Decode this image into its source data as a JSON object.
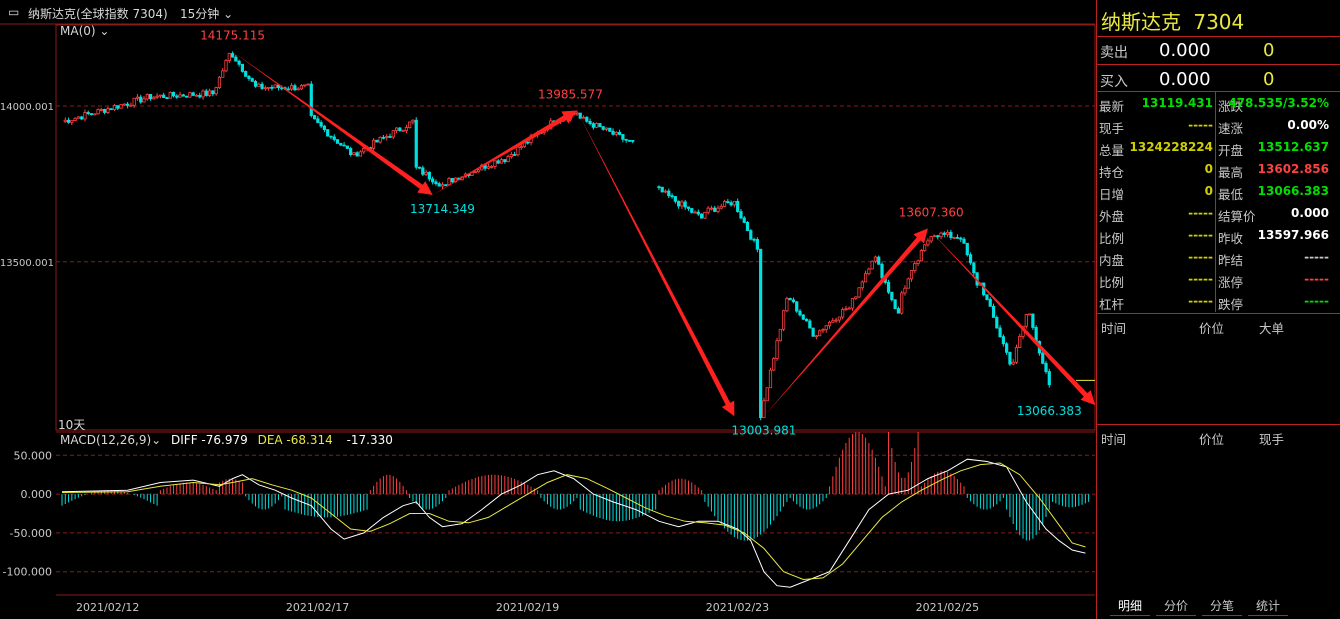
{
  "header": {
    "instrument": "纳斯达克(全球指数 7304)",
    "period": "15分钟",
    "ma_label": "MA(0)",
    "range_label": "10天",
    "icon": "chart-window-icon"
  },
  "macd": {
    "label": "MACD(12,26,9)",
    "diff": "DIFF -76.979",
    "dea": "DEA -68.314",
    "macd": "-17.330"
  },
  "quote": {
    "name": "纳斯达克",
    "code": "7304",
    "sell_label": "卖出",
    "sell_price": "0.000",
    "sell_vol": "0",
    "buy_label": "买入",
    "buy_price": "0.000",
    "buy_vol": "0",
    "rows": [
      {
        "l1": "最新",
        "v1": "13119.431",
        "c1": "#00e000",
        "l2": "涨跌",
        "v2": "478.535/3.52%",
        "c2": "#00e000"
      },
      {
        "l1": "现手",
        "v1": "-----",
        "c1": "#d0d000",
        "l2": "速涨",
        "v2": "0.00%",
        "c2": "#ffffff"
      },
      {
        "l1": "总量",
        "v1": "1324228224",
        "c1": "#d0d000",
        "l2": "开盘",
        "v2": "13512.637",
        "c2": "#00e000"
      },
      {
        "l1": "持仓",
        "v1": "0",
        "c1": "#d0d000",
        "l2": "最高",
        "v2": "13602.856",
        "c2": "#ff4040"
      },
      {
        "l1": "日增",
        "v1": "0",
        "c1": "#d0d000",
        "l2": "最低",
        "v2": "13066.383",
        "c2": "#00e000"
      },
      {
        "l1": "外盘",
        "v1": "-----",
        "c1": "#d0d000",
        "l2": "结算价",
        "v2": "0.000",
        "c2": "#ffffff"
      },
      {
        "l1": "比例",
        "v1": "-----",
        "c1": "#d0d000",
        "l2": "昨收",
        "v2": "13597.966",
        "c2": "#ffffff"
      },
      {
        "l1": "内盘",
        "v1": "-----",
        "c1": "#d0d000",
        "l2": "昨结",
        "v2": "-----",
        "c2": "#c8c8c8"
      },
      {
        "l1": "比例",
        "v1": "-----",
        "c1": "#d0d000",
        "l2": "涨停",
        "v2": "-----",
        "c2": "#ff4040"
      },
      {
        "l1": "杠杆",
        "v1": "-----",
        "c1": "#d0d000",
        "l2": "跌停",
        "v2": "-----",
        "c2": "#00e000"
      }
    ],
    "ticks_header": [
      "时间",
      "价位",
      "大单"
    ],
    "trades_header": [
      "时间",
      "价位",
      "现手"
    ],
    "tabs": [
      "明细",
      "分价",
      "分笔",
      "统计"
    ]
  },
  "colors": {
    "up": "#ff4040",
    "down": "#00e0e0",
    "arrow": "#ff2020",
    "grid": "#8b1a1a",
    "diff": "#ffffff",
    "dea": "#e8e840"
  },
  "chart_data": [
    {
      "type": "candlestick",
      "title": "纳斯达克(全球指数 7304) 15分钟",
      "x_tick_labels": [
        "2021/02/12",
        "2021/02/17",
        "2021/02/19",
        "2021/02/23",
        "2021/02/25"
      ],
      "y_tick_labels": [
        "14000.001",
        "13500.001"
      ],
      "ylim": [
        12960,
        14260
      ],
      "annotations": [
        {
          "text": "14175.115",
          "value": 14175.115,
          "kind": "high"
        },
        {
          "text": "13714.349",
          "value": 13714.349,
          "kind": "low"
        },
        {
          "text": "13985.577",
          "value": 13985.577,
          "kind": "high"
        },
        {
          "text": "13003.981",
          "value": 13003.981,
          "kind": "low"
        },
        {
          "text": "13607.360",
          "value": 13607.36,
          "kind": "high"
        },
        {
          "text": "13066.383",
          "value": 13066.383,
          "kind": "low"
        }
      ],
      "trend_arrows": [
        {
          "from": 14175.115,
          "to": 13714.349
        },
        {
          "from": 13714.349,
          "to": 13985.577
        },
        {
          "from": 13985.577,
          "to": 13003.981
        },
        {
          "from": 13003.981,
          "to": 13607.36
        },
        {
          "from": 13607.36,
          "to": 13040
        }
      ],
      "segments": [
        {
          "start": 0,
          "end": 28,
          "from": 13950,
          "to": 14030
        },
        {
          "start": 28,
          "end": 46,
          "from": 14030,
          "to": 14040
        },
        {
          "start": 46,
          "end": 52,
          "from": 14040,
          "to": 14165
        },
        {
          "start": 52,
          "end": 60,
          "from": 14165,
          "to": 14060
        },
        {
          "start": 60,
          "end": 76,
          "from": 14060,
          "to": 14060
        },
        {
          "start": 76,
          "end": 90,
          "from": 13960,
          "to": 13840
        },
        {
          "start": 90,
          "end": 108,
          "from": 13850,
          "to": 13950
        },
        {
          "start": 108,
          "end": 118,
          "from": 13800,
          "to": 13740
        },
        {
          "start": 118,
          "end": 135,
          "from": 13760,
          "to": 13830
        },
        {
          "start": 135,
          "end": 152,
          "from": 13830,
          "to": 13960
        },
        {
          "start": 152,
          "end": 158,
          "from": 13960,
          "to": 13980
        },
        {
          "start": 158,
          "end": 175,
          "from": 13960,
          "to": 13880
        },
        {
          "start": 182,
          "end": 196,
          "from": 13730,
          "to": 13640
        },
        {
          "start": 196,
          "end": 205,
          "from": 13660,
          "to": 13690
        },
        {
          "start": 205,
          "end": 213,
          "from": 13690,
          "to": 13540
        },
        {
          "start": 213,
          "end": 222,
          "from": 13010,
          "to": 13380
        },
        {
          "start": 222,
          "end": 230,
          "from": 13380,
          "to": 13270
        },
        {
          "start": 230,
          "end": 240,
          "from": 13270,
          "to": 13350
        },
        {
          "start": 240,
          "end": 248,
          "from": 13350,
          "to": 13510
        },
        {
          "start": 248,
          "end": 256,
          "from": 13510,
          "to": 13330
        },
        {
          "start": 256,
          "end": 266,
          "from": 13400,
          "to": 13590
        },
        {
          "start": 266,
          "end": 274,
          "from": 13590,
          "to": 13580
        },
        {
          "start": 274,
          "end": 280,
          "from": 13580,
          "to": 13430
        },
        {
          "start": 280,
          "end": 290,
          "from": 13430,
          "to": 13180
        },
        {
          "start": 290,
          "end": 295,
          "from": 13180,
          "to": 13330
        },
        {
          "start": 295,
          "end": 302,
          "from": 13330,
          "to": 13100
        }
      ]
    },
    {
      "type": "bar+line",
      "title": "MACD(12,26,9)",
      "y_tick_labels": [
        "50.000",
        "0.000",
        "-50.000",
        "-100.000"
      ],
      "ylim": [
        -130,
        80
      ],
      "series": [
        {
          "name": "DIFF",
          "points": [
            [
              0,
              3
            ],
            [
              20,
              5
            ],
            [
              30,
              15
            ],
            [
              40,
              18
            ],
            [
              48,
              10
            ],
            [
              52,
              20
            ],
            [
              55,
              25
            ],
            [
              60,
              12
            ],
            [
              65,
              5
            ],
            [
              70,
              -5
            ],
            [
              76,
              -15
            ],
            [
              82,
              -45
            ],
            [
              86,
              -58
            ],
            [
              92,
              -50
            ],
            [
              98,
              -30
            ],
            [
              104,
              -15
            ],
            [
              108,
              -10
            ],
            [
              112,
              -30
            ],
            [
              116,
              -42
            ],
            [
              122,
              -38
            ],
            [
              128,
              -20
            ],
            [
              134,
              0
            ],
            [
              140,
              12
            ],
            [
              145,
              25
            ],
            [
              150,
              30
            ],
            [
              156,
              20
            ],
            [
              162,
              0
            ],
            [
              168,
              -10
            ],
            [
              175,
              -20
            ],
            [
              182,
              -35
            ],
            [
              188,
              -42
            ],
            [
              194,
              -35
            ],
            [
              200,
              -35
            ],
            [
              206,
              -45
            ],
            [
              210,
              -60
            ],
            [
              214,
              -100
            ],
            [
              218,
              -118
            ],
            [
              222,
              -120
            ],
            [
              228,
              -110
            ],
            [
              234,
              -100
            ],
            [
              240,
              -60
            ],
            [
              246,
              -20
            ],
            [
              252,
              0
            ],
            [
              258,
              5
            ],
            [
              264,
              20
            ],
            [
              270,
              30
            ],
            [
              276,
              45
            ],
            [
              282,
              42
            ],
            [
              288,
              35
            ],
            [
              294,
              -10
            ],
            [
              300,
              -45
            ],
            [
              304,
              -60
            ],
            [
              308,
              -72
            ],
            [
              312,
              -76
            ]
          ]
        },
        {
          "name": "DEA",
          "points": [
            [
              0,
              2
            ],
            [
              20,
              3
            ],
            [
              30,
              10
            ],
            [
              40,
              15
            ],
            [
              48,
              12
            ],
            [
              52,
              15
            ],
            [
              58,
              20
            ],
            [
              64,
              12
            ],
            [
              70,
              5
            ],
            [
              76,
              -5
            ],
            [
              82,
              -25
            ],
            [
              88,
              -45
            ],
            [
              94,
              -48
            ],
            [
              100,
              -38
            ],
            [
              106,
              -25
            ],
            [
              112,
              -25
            ],
            [
              118,
              -35
            ],
            [
              124,
              -37
            ],
            [
              130,
              -30
            ],
            [
              136,
              -15
            ],
            [
              142,
              0
            ],
            [
              148,
              15
            ],
            [
              154,
              25
            ],
            [
              160,
              20
            ],
            [
              166,
              8
            ],
            [
              172,
              -5
            ],
            [
              178,
              -18
            ],
            [
              184,
              -28
            ],
            [
              190,
              -35
            ],
            [
              196,
              -37
            ],
            [
              202,
              -40
            ],
            [
              208,
              -50
            ],
            [
              214,
              -70
            ],
            [
              220,
              -100
            ],
            [
              226,
              -110
            ],
            [
              232,
              -108
            ],
            [
              238,
              -90
            ],
            [
              244,
              -60
            ],
            [
              250,
              -30
            ],
            [
              256,
              -10
            ],
            [
              262,
              5
            ],
            [
              268,
              18
            ],
            [
              274,
              30
            ],
            [
              280,
              38
            ],
            [
              286,
              40
            ],
            [
              292,
              25
            ],
            [
              298,
              -5
            ],
            [
              304,
              -40
            ],
            [
              308,
              -63
            ],
            [
              312,
              -68
            ]
          ]
        }
      ],
      "hist_segments": [
        {
          "start": 0,
          "end": 30,
          "from": -15,
          "to": 5
        },
        {
          "start": 30,
          "end": 48,
          "from": 5,
          "to": 15
        },
        {
          "start": 48,
          "end": 56,
          "from": 15,
          "to": 20
        },
        {
          "start": 56,
          "end": 68,
          "from": -3,
          "to": -20
        },
        {
          "start": 68,
          "end": 94,
          "from": -20,
          "to": -30
        },
        {
          "start": 94,
          "end": 106,
          "from": 5,
          "to": 25
        },
        {
          "start": 106,
          "end": 118,
          "from": -5,
          "to": -20
        },
        {
          "start": 118,
          "end": 146,
          "from": 5,
          "to": 25
        },
        {
          "start": 146,
          "end": 158,
          "from": -5,
          "to": -20
        },
        {
          "start": 158,
          "end": 182,
          "from": -20,
          "to": -35
        },
        {
          "start": 182,
          "end": 196,
          "from": 5,
          "to": 20
        },
        {
          "start": 196,
          "end": 222,
          "from": -10,
          "to": -60
        },
        {
          "start": 222,
          "end": 234,
          "from": -5,
          "to": -20
        },
        {
          "start": 234,
          "end": 252,
          "from": 10,
          "to": 80
        },
        {
          "start": 252,
          "end": 262,
          "from": 80,
          "to": 20
        },
        {
          "start": 262,
          "end": 276,
          "from": 10,
          "to": 30
        },
        {
          "start": 276,
          "end": 288,
          "from": -5,
          "to": -20
        },
        {
          "start": 288,
          "end": 302,
          "from": -20,
          "to": -60
        },
        {
          "start": 302,
          "end": 314,
          "from": -10,
          "to": -17
        }
      ]
    }
  ]
}
